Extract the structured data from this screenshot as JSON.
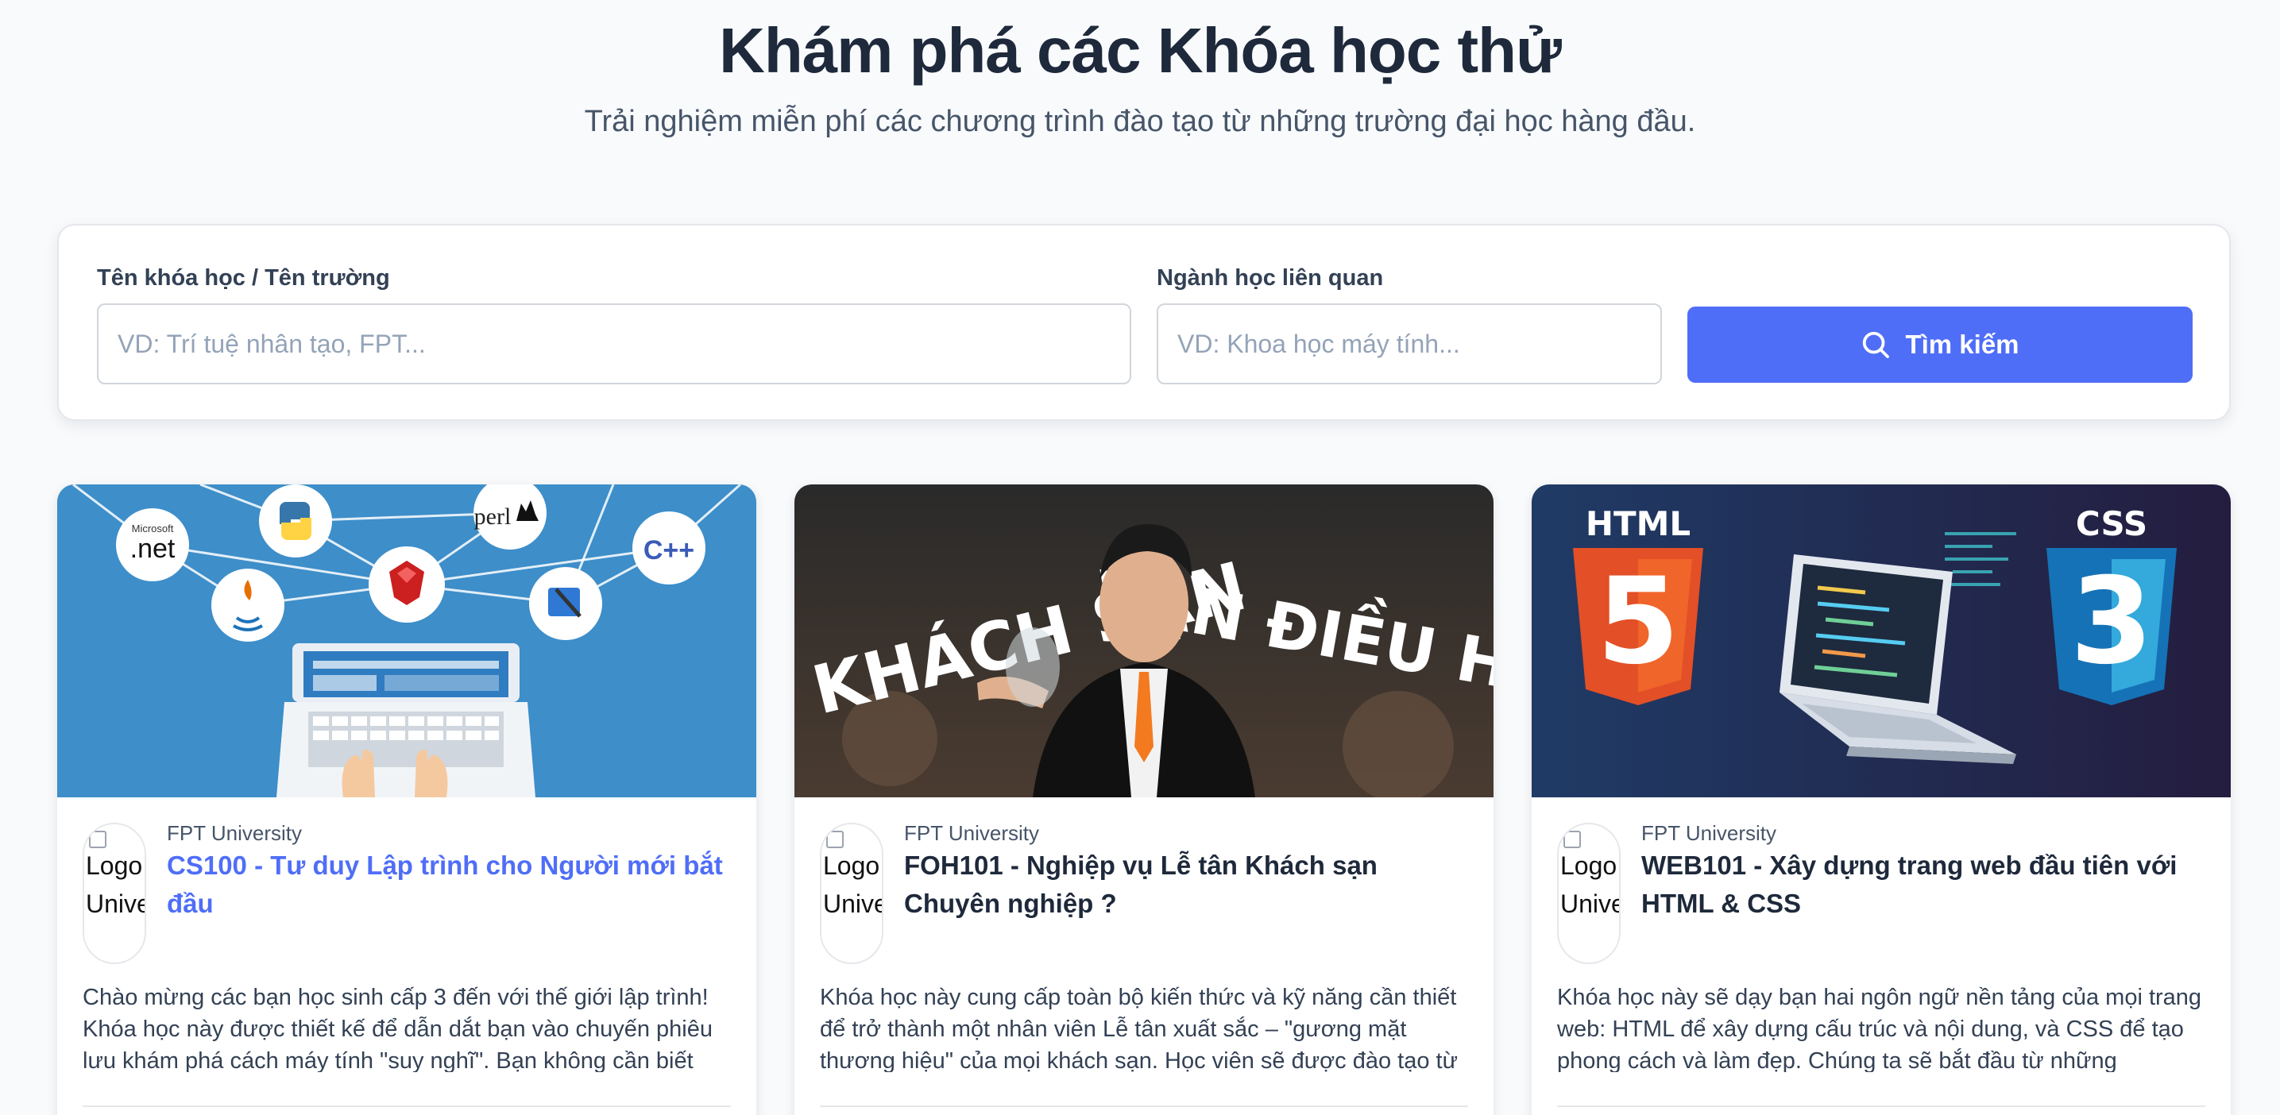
{
  "hero": {
    "title": "Khám phá các Khóa học thử",
    "subtitle": "Trải nghiệm miễn phí các chương trình đào tạo từ những trường đại học hàng đầu."
  },
  "search": {
    "course_label": "Tên khóa học / Tên trường",
    "course_placeholder": "VD: Trí tuệ nhân tạo, FPT...",
    "course_value": "",
    "major_label": "Ngành học liên quan",
    "major_placeholder": "VD: Khoa học máy tính...",
    "major_value": "",
    "button_label": "Tìm kiếm",
    "button_icon": "search-icon",
    "accent_color": "#4f6ef7"
  },
  "courses": [
    {
      "university": "FPT University",
      "logo_alt": "Logo FPT University",
      "title": "CS100 - Tư duy Lập trình cho Người mới bắt đầu",
      "description": "Chào mừng các bạn học sinh cấp 3 đến với thế giới lập trình! Khóa học này được thiết kế để dẫn dắt bạn vào chuyến phiêu lưu khám phá cách máy tính \"suy nghĩ\". Bạn không cần biết",
      "image": {
        "bubble_net_small": "Microsoft",
        "bubble_net": ".net",
        "bubble_perl": "perl",
        "bubble_cpp": "C++"
      }
    },
    {
      "university": "FPT University",
      "logo_alt": "Logo FPT University",
      "title": "FOH101 - Nghiệp vụ Lễ tân Khách sạn Chuyên nghiệp ?",
      "description": "Khóa học này cung cấp toàn bộ kiến thức và kỹ năng cần thiết để trở thành một nhân viên Lễ tân xuất sắc – \"gương mặt thương hiệu\" của mọi khách sạn. Học viên sẽ được đào tạo từ",
      "image": {
        "text_left": "HỌC KHÁCH SẠN",
        "text_right": "VẠN ĐIỀU HAY"
      }
    },
    {
      "university": "FPT University",
      "logo_alt": "Logo FPT University",
      "title": "WEB101 - Xây dựng trang web đầu tiên với HTML & CSS",
      "description": "Khóa học này sẽ dạy bạn hai ngôn ngữ nền tảng của mọi trang web: HTML để xây dựng cấu trúc và nội dung, và CSS để tạo phong cách và làm đẹp. Chúng ta sẽ bắt đầu từ những",
      "image": {
        "html_label": "HTML",
        "html_number": "5",
        "css_label": "CSS",
        "css_number": "3"
      }
    }
  ]
}
